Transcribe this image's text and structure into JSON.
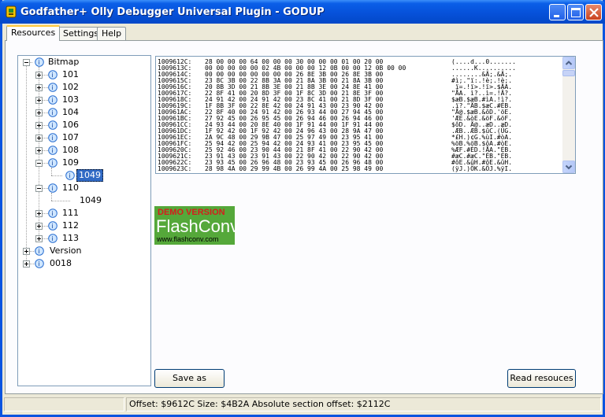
{
  "window": {
    "title": "Godfather+ Olly Debugger Universal Plugin - GODUP"
  },
  "tabs": [
    "Resources",
    "Settings",
    "Help"
  ],
  "tree": {
    "root": "Bitmap",
    "items": [
      "101",
      "102",
      "103",
      "104",
      "106",
      "107",
      "108",
      "109",
      "1049",
      "110",
      "1049",
      "111",
      "112",
      "113",
      "Version",
      "0018"
    ]
  },
  "hex": {
    "rows": [
      {
        "addr": "1009612C:",
        "hex": "28 00 00 00 64 00 00 00 30 00 00 00 01 00 20 00",
        "asc": "(....d...0......."
      },
      {
        "addr": "1009613C:",
        "hex": "00 00 00 00 00 02 4B 00 00 00 12 0B 00 00 12 0B 00 00",
        "asc": "......K.........."
      },
      {
        "addr": "1009614C:",
        "hex": "00 00 00 00 00 00 00 00 26 8E 3B 00 26 8E 3B 00",
        "asc": "........&Ä;.&Ä;."
      },
      {
        "addr": "1009615C:",
        "hex": "23 8C 3B 00 22 8B 3A 00 21 8A 3B 00 21 8A 3B 00",
        "asc": "#ì;.\"ï:.!è;.!è;."
      },
      {
        "addr": "1009616C:",
        "hex": "20 8B 3D 00 21 8B 3E 00 21 8B 3E 00 24 8E 41 00",
        "asc": " ï=.!ï>.!ï>.$ÄA."
      },
      {
        "addr": "1009617C:",
        "hex": "22 8F 41 00 20 8D 3F 00 1F 8C 3D 00 21 8E 3F 00",
        "asc": "\"ÅA. ì?..ì=.!Ä?."
      },
      {
        "addr": "1009618C:",
        "hex": "24 91 42 00 24 91 42 00 23 8C 41 00 21 8D 3F 00",
        "asc": "$æB.$æB.#ìA.!ì?."
      },
      {
        "addr": "1009619C:",
        "hex": "1F 8B 3F 00 22 8E 42 00 24 91 43 00 23 90 42 00",
        "asc": ".ï?.\"ÄB.$æC.#ÉB."
      },
      {
        "addr": "100961AC:",
        "hex": "22 8F 40 00 24 91 42 00 26 93 44 00 27 94 45 00",
        "asc": "\"Å@.$æB.&ôD.'öE."
      },
      {
        "addr": "100961BC:",
        "hex": "27 92 45 00 26 95 45 00 26 94 46 00 26 94 46 00",
        "asc": "'ÆE.&òE.&öF.&öF."
      },
      {
        "addr": "100961CC:",
        "hex": "24 93 44 00 20 8E 40 00 1F 91 44 00 1F 91 44 00",
        "asc": "$ôD. Ä@..æD..æD."
      },
      {
        "addr": "100961DC:",
        "hex": "1F 92 42 00 1F 92 42 00 24 96 43 00 28 9A 47 00",
        "asc": ".ÆB..ÆB.$ûC.(ÜG."
      },
      {
        "addr": "100961EC:",
        "hex": "2A 9C 48 00 29 9B 47 00 25 97 49 00 23 95 41 00",
        "asc": "*£H.)¢G.%ùI.#òA."
      },
      {
        "addr": "100961FC:",
        "hex": "25 94 42 00 25 94 42 00 24 93 41 00 23 95 45 00",
        "asc": "%öB.%öB.$ôA.#òE."
      },
      {
        "addr": "1009620C:",
        "hex": "25 92 46 00 23 90 44 00 21 8F 41 00 22 90 42 00",
        "asc": "%ÆF.#ÉD.!ÅA.\"ÉB."
      },
      {
        "addr": "1009621C:",
        "hex": "23 91 43 00 23 91 43 00 22 90 42 00 22 90 42 00",
        "asc": "#æC.#æC.\"ÉB.\"ÉB."
      },
      {
        "addr": "1009622C:",
        "hex": "23 93 45 00 26 96 48 00 23 93 45 00 26 96 48 00",
        "asc": "#ôE.&ûH.#ôE.&ûH."
      },
      {
        "addr": "1009623C:",
        "hex": "28 98 4A 00 29 99 4B 00 26 99 4A 00 25 98 49 00",
        "asc": "(ÿJ.)ÖK.&ÖJ.%ÿI."
      }
    ]
  },
  "demo": {
    "line1": "DEMO VERSION",
    "line2": "FlashConv",
    "line3": "www.flashconv.com"
  },
  "buttons": {
    "save_as": "Save as",
    "read_resources": "Read resouces"
  },
  "status": {
    "text": "Offset: $9612C  Size: $4B2A Absolute section offset: $2112C"
  }
}
